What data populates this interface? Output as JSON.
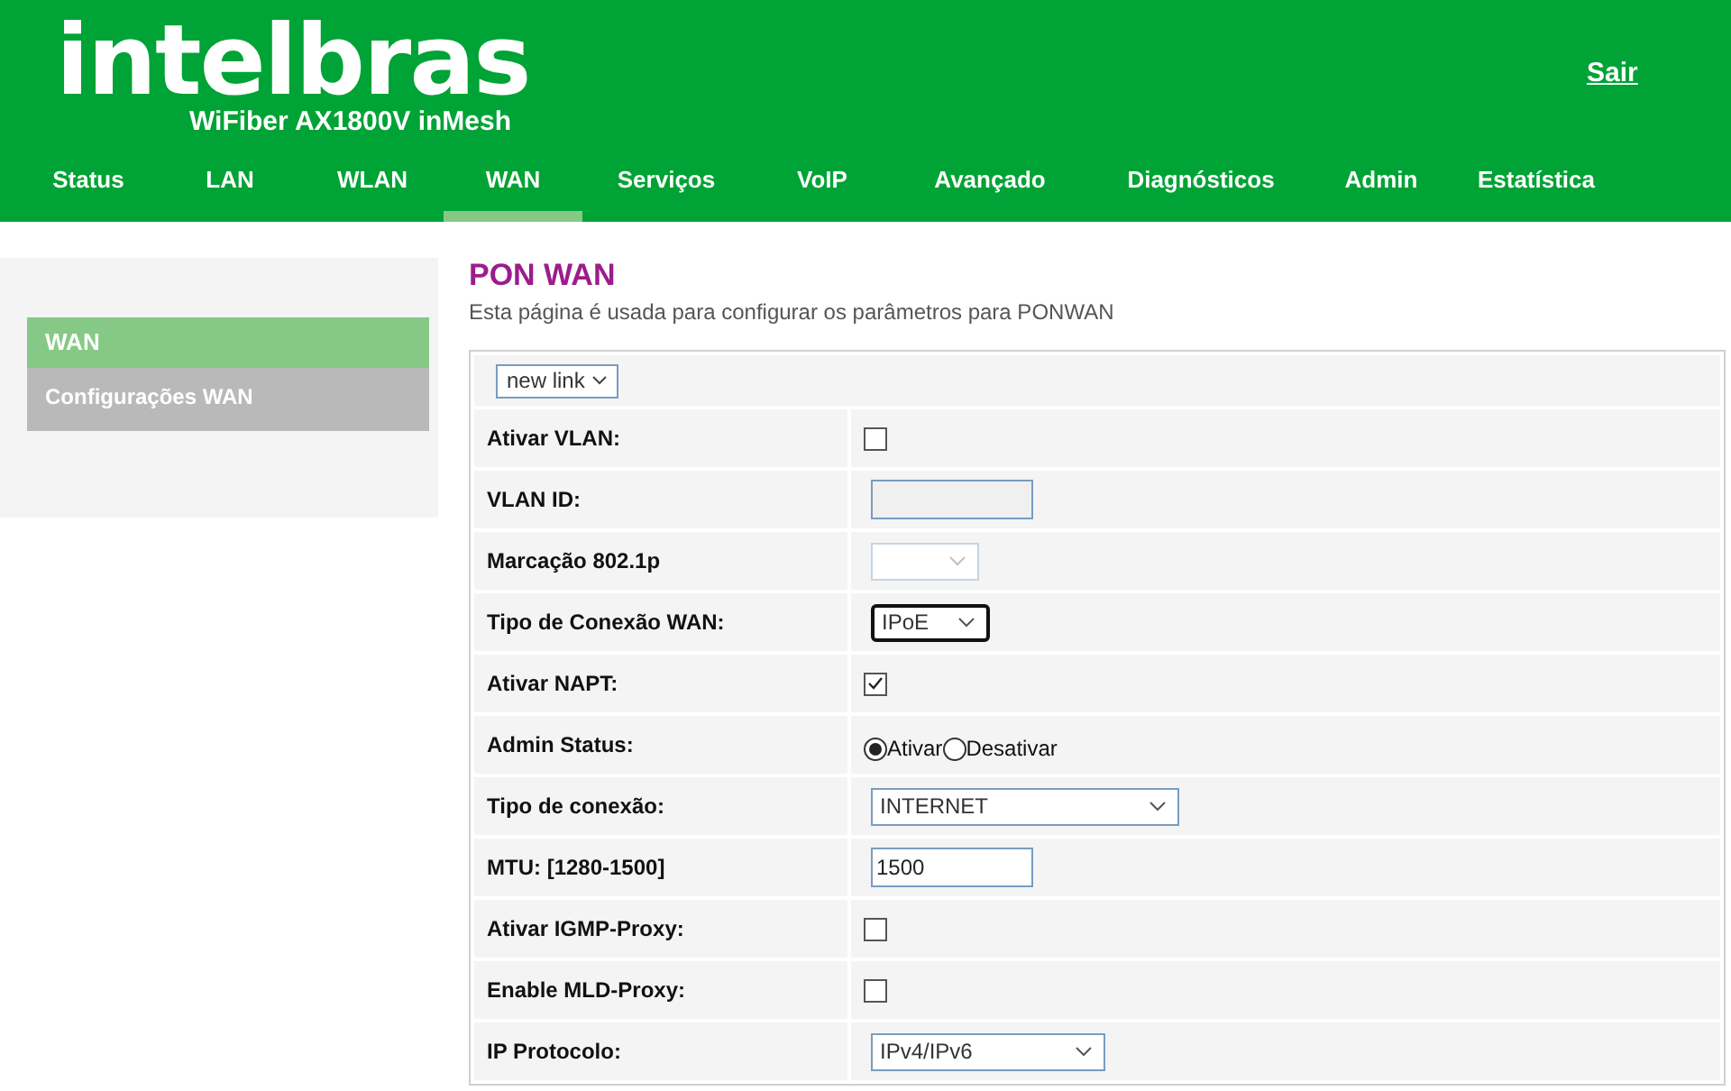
{
  "header": {
    "logo": "intelbras",
    "model": "WiFiber AX1800V inMesh",
    "logout": "Sair"
  },
  "nav": [
    {
      "label": "Status",
      "selected": false
    },
    {
      "label": "LAN",
      "selected": false
    },
    {
      "label": "WLAN",
      "selected": false
    },
    {
      "label": "WAN",
      "selected": true
    },
    {
      "label": "Serviços",
      "selected": false
    },
    {
      "label": "VoIP",
      "selected": false
    },
    {
      "label": "Avançado",
      "selected": false
    },
    {
      "label": "Diagnósticos",
      "selected": false
    },
    {
      "label": "Admin",
      "selected": false
    },
    {
      "label": "Estatística",
      "selected": false
    }
  ],
  "sidebar": {
    "items": [
      {
        "label": "WAN",
        "kind": "header"
      },
      {
        "label": "Configurações WAN",
        "kind": "item"
      }
    ]
  },
  "page": {
    "title": "PON WAN",
    "description": "Esta página é usada para configurar os parâmetros para PONWAN",
    "link_select": "new link"
  },
  "form": [
    {
      "label": "Ativar VLAN:",
      "kind": "checkbox",
      "checked": false
    },
    {
      "label": "VLAN ID:",
      "kind": "text",
      "disabled": true
    },
    {
      "label": "Marcação 802.1p",
      "kind": "select",
      "disabled": true,
      "focused": false
    },
    {
      "label": "Tipo de Conexão WAN:",
      "kind": "select",
      "value": "IPoE",
      "disabled": false,
      "focused": true
    },
    {
      "label": "Ativar NAPT:",
      "kind": "checkbox",
      "checked": true
    },
    {
      "label": "Admin Status:",
      "kind": "radio",
      "options": [
        {
          "label": "Ativar",
          "selected": true
        },
        {
          "label": "Desativar",
          "selected": false
        }
      ]
    },
    {
      "label": "Tipo de conexão:",
      "kind": "select",
      "value": "INTERNET",
      "disabled": false,
      "focused": false
    },
    {
      "label": "MTU: [1280-1500]",
      "kind": "text",
      "value": "1500",
      "disabled": false
    },
    {
      "label": "Ativar IGMP-Proxy:",
      "kind": "checkbox",
      "checked": false
    },
    {
      "label": "Enable MLD-Proxy:",
      "kind": "checkbox",
      "checked": false
    },
    {
      "label": "IP Protocolo:",
      "kind": "select",
      "value": "IPv4/IPv6",
      "disabled": false,
      "focused": false
    }
  ]
}
